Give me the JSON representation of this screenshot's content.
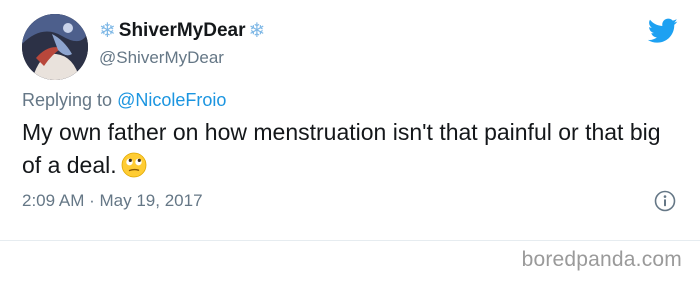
{
  "user": {
    "display_name": "ShiverMyDear",
    "name_decoration_icon": "snowflake-icon",
    "handle": "@ShiverMyDear"
  },
  "tweet": {
    "replying_prefix": "Replying to",
    "replying_to": "@NicoleFroio",
    "text": "My own father on how menstruation isn't that painful or that big of a deal.",
    "emoji": "face-with-rolling-eyes",
    "time": "2:09 AM",
    "separator": "·",
    "date": "May 19, 2017"
  },
  "colors": {
    "twitter_blue": "#1da1f2",
    "mention_blue": "#1b95e0",
    "secondary_text": "#657786",
    "snowflake": "#7fb8e6"
  },
  "watermark": "boredpanda.com"
}
